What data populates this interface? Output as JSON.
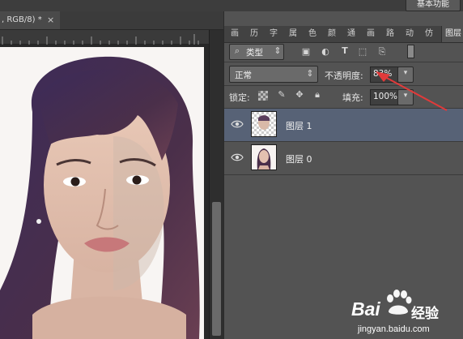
{
  "workspace": {
    "label": "基本功能"
  },
  "document": {
    "tab_label": ", RGB/8) *",
    "close_glyph": "×"
  },
  "panel": {
    "tabs": [
      "画",
      "历",
      "字",
      "属",
      "色",
      "颜",
      "通",
      "画",
      "路",
      "动",
      "仿",
      "图层"
    ],
    "active_tab": "图层",
    "filter_label": "类型",
    "blend_mode": "正常",
    "opacity_label": "不透明度:",
    "opacity_value": "83%",
    "lock_label": "锁定:",
    "fill_label": "填充:",
    "fill_value": "100%",
    "layers": [
      {
        "name": "图层 1",
        "selected": true,
        "visible": true
      },
      {
        "name": "图层 0",
        "selected": false,
        "visible": true
      }
    ]
  },
  "watermark": {
    "logo_text": "Bai",
    "logo_suffix": "经验",
    "url": "jingyan.baidu.com"
  },
  "colors": {
    "selected_layer": "#576276",
    "arrow": "#e13a3a",
    "panel_bg": "#535353"
  }
}
